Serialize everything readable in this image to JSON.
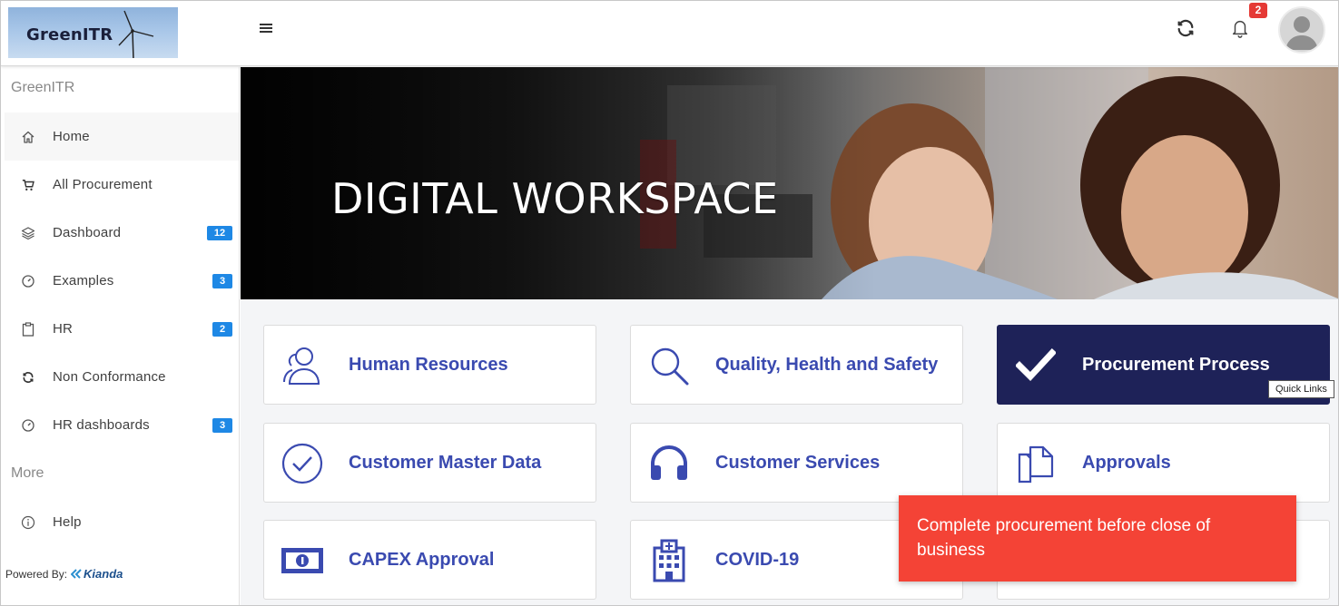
{
  "header": {
    "logo_text": "GreenITR",
    "menu_icon": "hamburger-icon",
    "refresh_icon": "refresh-icon",
    "notification_icon": "bell-icon",
    "notification_count": "2",
    "avatar_icon": "user-avatar"
  },
  "sidebar": {
    "title": "GreenITR",
    "items": [
      {
        "label": "Home",
        "icon": "home-icon",
        "badge": ""
      },
      {
        "label": "All Procurement",
        "icon": "cart-icon",
        "badge": ""
      },
      {
        "label": "Dashboard",
        "icon": "layers-icon",
        "badge": "12"
      },
      {
        "label": "Examples",
        "icon": "gauge-icon",
        "badge": "3"
      },
      {
        "label": "HR",
        "icon": "clipboard-icon",
        "badge": "2"
      },
      {
        "label": "Non Conformance",
        "icon": "refresh-icon",
        "badge": ""
      },
      {
        "label": "HR dashboards",
        "icon": "gauge-icon",
        "badge": "3"
      }
    ],
    "more_title": "More",
    "more_items": [
      {
        "label": "Help",
        "icon": "info-icon"
      }
    ],
    "powered_by": "Powered By:",
    "brand": "Kianda"
  },
  "hero": {
    "title": "DIGITAL WORKSPACE"
  },
  "tiles": [
    {
      "label": "Human Resources",
      "icon": "users-icon"
    },
    {
      "label": "Quality, Health and Safety",
      "icon": "search-icon"
    },
    {
      "label": "Procurement Process",
      "icon": "check-icon"
    },
    {
      "label": "Customer Master Data",
      "icon": "check-circle-icon"
    },
    {
      "label": "Customer Services",
      "icon": "headphones-icon"
    },
    {
      "label": "Approvals",
      "icon": "copy-icon"
    },
    {
      "label": "CAPEX Approval",
      "icon": "money-icon"
    },
    {
      "label": "COVID-19",
      "icon": "hospital-icon"
    }
  ],
  "tooltip": "Quick Links",
  "toast": {
    "message": "Complete procurement before close of business"
  },
  "colors": {
    "tile_text": "#3a4ab0",
    "tile_dark_bg": "#1e2258",
    "badge_blue": "#1e88e5",
    "toast_red": "#f44336"
  }
}
